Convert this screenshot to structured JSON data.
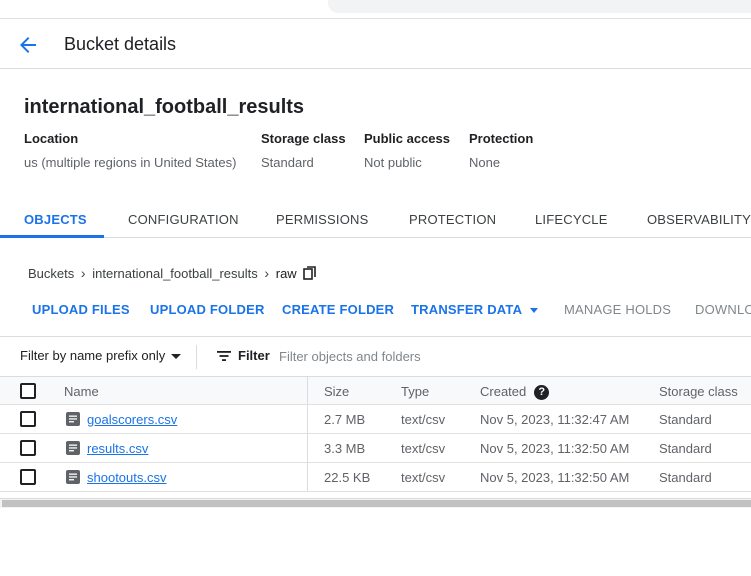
{
  "header": {
    "title": "Bucket details",
    "back_icon": "arrow-back-icon"
  },
  "bucket": {
    "name": "international_football_results",
    "properties": [
      {
        "label": "Location",
        "value": "us (multiple regions in United States)"
      },
      {
        "label": "Storage class",
        "value": "Standard"
      },
      {
        "label": "Public access",
        "value": "Not public"
      },
      {
        "label": "Protection",
        "value": "None"
      }
    ]
  },
  "tabs": [
    "OBJECTS",
    "CONFIGURATION",
    "PERMISSIONS",
    "PROTECTION",
    "LIFECYCLE",
    "OBSERVABILITY"
  ],
  "active_tab": "OBJECTS",
  "breadcrumb": {
    "items": [
      "Buckets",
      "international_football_results"
    ],
    "current": "raw",
    "copy_icon": "copy-icon"
  },
  "actions": {
    "upload_files": "UPLOAD FILES",
    "upload_folder": "UPLOAD FOLDER",
    "create_folder": "CREATE FOLDER",
    "transfer_data": "TRANSFER DATA",
    "manage_holds": "MANAGE HOLDS",
    "download": "DOWNLOAD"
  },
  "filter": {
    "prefix_select": "Filter by name prefix only",
    "button": "Filter",
    "placeholder": "Filter objects and folders"
  },
  "table": {
    "columns": {
      "name": "Name",
      "size": "Size",
      "type": "Type",
      "created": "Created",
      "storage_class": "Storage class"
    },
    "rows": [
      {
        "name": "goalscorers.csv",
        "size": "2.7 MB",
        "type": "text/csv",
        "created": "Nov 5, 2023, 11:32:47 AM",
        "storage_class": "Standard"
      },
      {
        "name": "results.csv",
        "size": "3.3 MB",
        "type": "text/csv",
        "created": "Nov 5, 2023, 11:32:50 AM",
        "storage_class": "Standard"
      },
      {
        "name": "shootouts.csv",
        "size": "22.5 KB",
        "type": "text/csv",
        "created": "Nov 5, 2023, 11:32:50 AM",
        "storage_class": "Standard"
      }
    ]
  },
  "colors": {
    "accent": "#1a73e8",
    "text": "#202124",
    "muted": "#5f6368",
    "border": "#dadce0"
  }
}
